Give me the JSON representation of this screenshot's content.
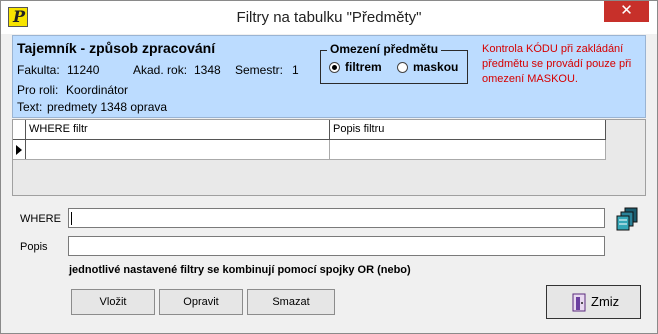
{
  "window": {
    "title": "Filtry na tabulku \"Předměty\"",
    "close_glyph": "✕",
    "app_icon_letter": "P"
  },
  "info": {
    "heading": "Tajemník - způsob zpracování",
    "fakulta_label": "Fakulta:",
    "fakulta_value": "11240",
    "rok_label": "Akad. rok:",
    "rok_value": "1348",
    "semestr_label": "Semestr:",
    "semestr_value": "1",
    "role_label": "Pro roli:",
    "role_value": "Koordinátor",
    "text_label": "Text:",
    "text_value": "predmety 1348 oprava"
  },
  "omezeni": {
    "legend": "Omezení předmětu",
    "options": [
      {
        "label": "filtrem",
        "selected": true
      },
      {
        "label": "maskou",
        "selected": false
      }
    ]
  },
  "note": "Kontrola KÓDU při zakládání předmětu se provádí pouze při omezení MASKOU.",
  "grid": {
    "columns": [
      "WHERE filtr",
      "Popis filtru"
    ],
    "rows": [
      {
        "where": "",
        "popis": ""
      }
    ]
  },
  "form": {
    "where_label": "WHERE",
    "where_value": "",
    "popis_label": "Popis",
    "popis_value": "",
    "hint": "jednotlivé nastavené filtry se kombinují pomocí spojky OR (nebo)"
  },
  "buttons": {
    "vlozit": "Vložit",
    "opravit": "Opravit",
    "smazat": "Smazat",
    "zmiz": "Zmiz"
  },
  "colors": {
    "info_bg": "#bcdcff",
    "note": "#d60000",
    "close": "#c7302a"
  }
}
